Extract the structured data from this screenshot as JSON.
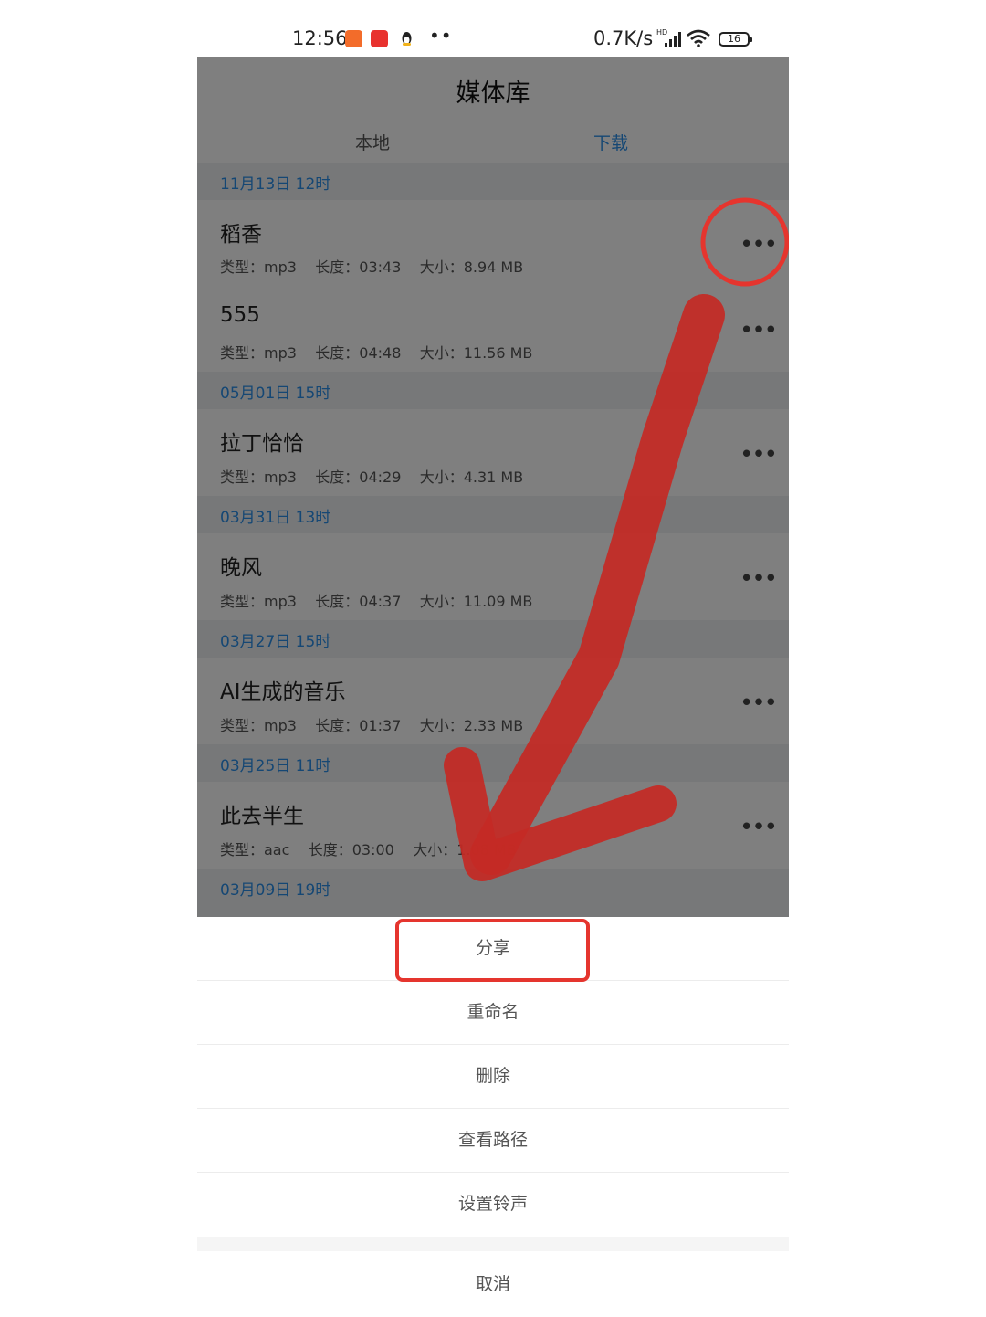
{
  "status_bar": {
    "time": "12:56",
    "dots": "••",
    "net_speed": "0.7K/s",
    "signal_label": "HD",
    "battery": "16"
  },
  "app": {
    "title": "媒体库",
    "tabs": [
      {
        "label": "本地",
        "active": false
      },
      {
        "label": "下载",
        "active": true
      }
    ],
    "more_glyph": "•••",
    "groups": [
      {
        "date": "11月13日  12时",
        "items": [
          {
            "name": "稻香",
            "meta": "类型：mp3    长度：03:43    大小：8.94 MB"
          },
          {
            "name": "555",
            "meta": "类型：mp3    长度：04:48    大小：11.56 MB"
          }
        ]
      },
      {
        "date": "05月01日  15时",
        "items": [
          {
            "name": "拉丁恰恰",
            "meta": "类型：mp3    长度：04:29    大小：4.31 MB"
          }
        ]
      },
      {
        "date": "03月31日  13时",
        "items": [
          {
            "name": "晚风",
            "meta": "类型：mp3    长度：04:37    大小：11.09 MB"
          }
        ]
      },
      {
        "date": "03月27日  15时",
        "items": [
          {
            "name": "AI生成的音乐",
            "meta": "类型：mp3    长度：01:37    大小：2.33 MB"
          }
        ]
      },
      {
        "date": "03月25日  11时",
        "items": [
          {
            "name": "此去半生",
            "meta": "类型：aac    长度：03:00    大小：1.08 MB"
          }
        ]
      },
      {
        "date": "03月09日  19时",
        "items": []
      }
    ]
  },
  "action_sheet": {
    "items": [
      "分享",
      "重命名",
      "删除",
      "查看路径",
      "设置铃声"
    ],
    "cancel": "取消"
  },
  "colors": {
    "accent": "#2b8fe8",
    "annotation_red": "#e5352e"
  }
}
